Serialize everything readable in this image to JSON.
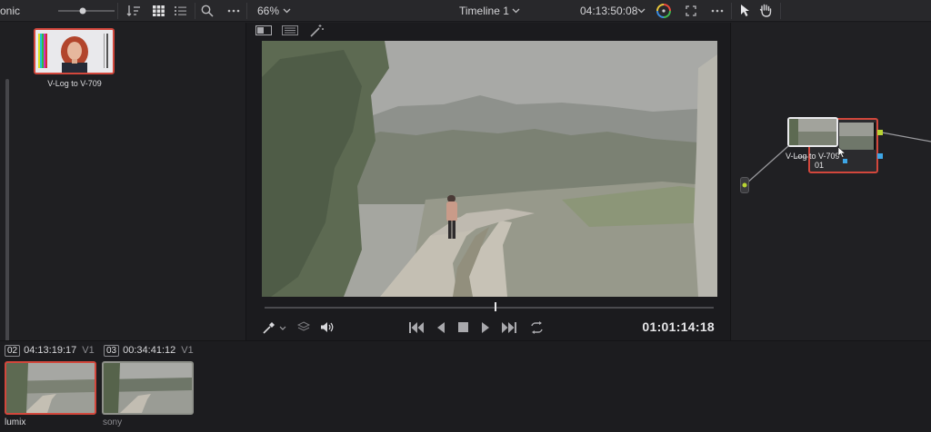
{
  "top_bar": {
    "left_text": "onic",
    "zoom": "66%",
    "timeline_name": "Timeline 1",
    "timecode": "04:13:50:08"
  },
  "gallery": {
    "stills": [
      {
        "label": "V-Log to V-709"
      }
    ]
  },
  "viewer": {
    "timecode": "01:01:14:18"
  },
  "node_editor": {
    "node_label": "V-Log to V-709",
    "node_number": "01"
  },
  "clips": [
    {
      "number": "02",
      "timecode": "04:13:19:17",
      "track": "V1",
      "name": "lumix",
      "selected": true
    },
    {
      "number": "03",
      "timecode": "00:34:41:12",
      "track": "V1",
      "name": "sony",
      "selected": false
    }
  ],
  "colors": {
    "accent_red": "#d2473c",
    "node_green": "#b8d433",
    "node_blue": "#3ea6e6"
  }
}
